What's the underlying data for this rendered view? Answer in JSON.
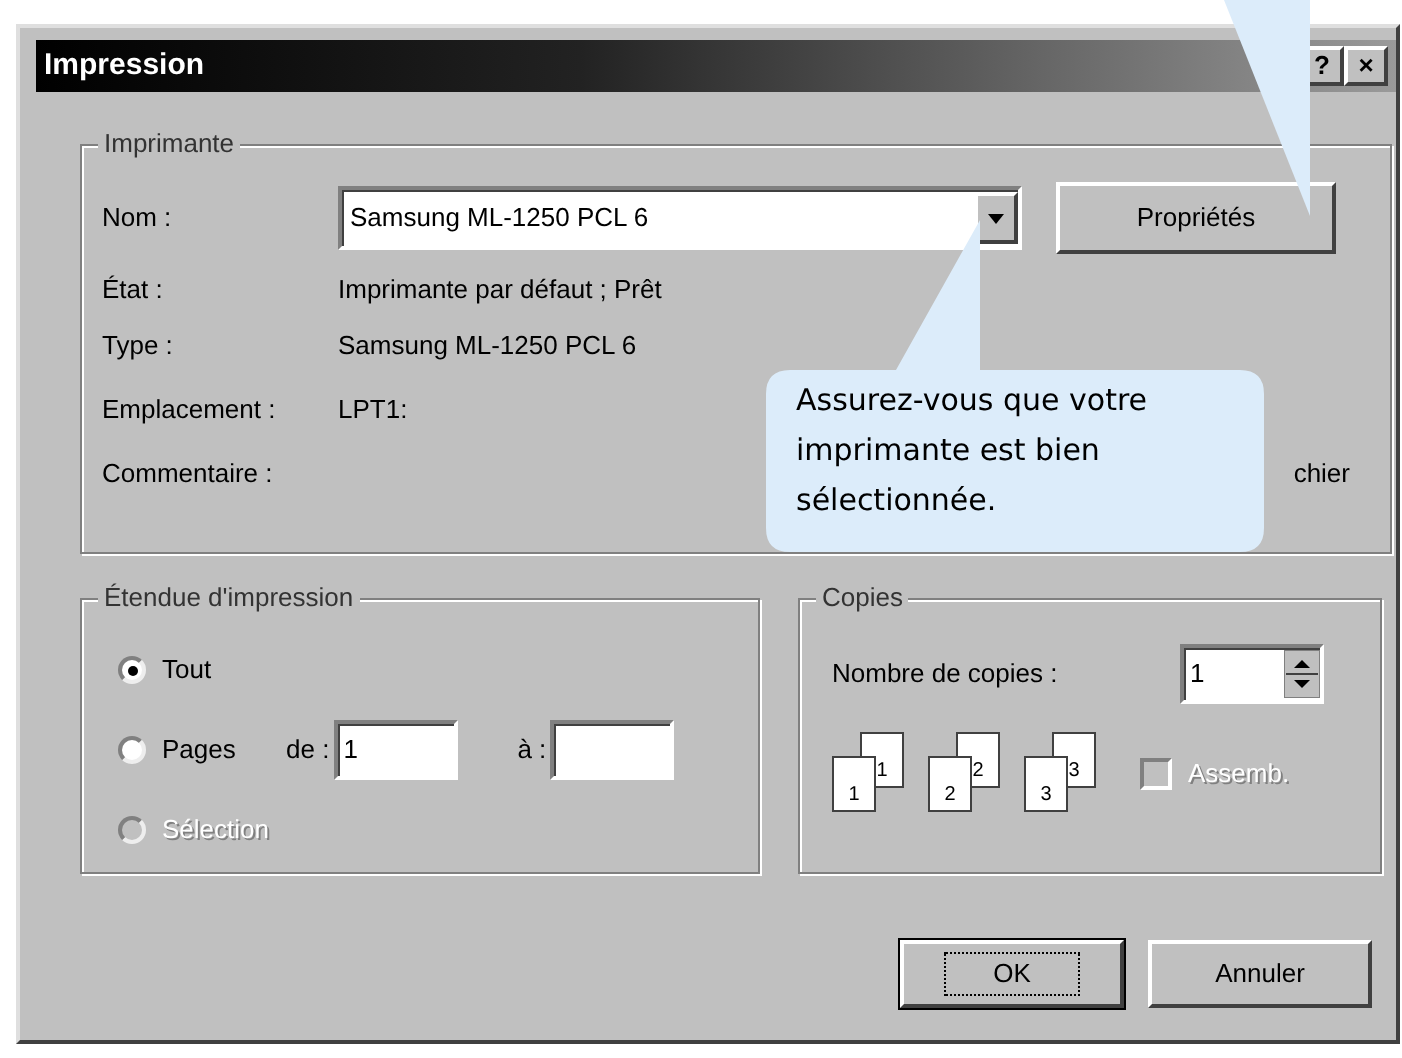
{
  "window": {
    "title": "Impression",
    "buttons": [
      "?",
      "×"
    ]
  },
  "printer": {
    "label": "Imprimante",
    "name_label": "Nom :",
    "name_value": "Samsung ML-1250 PCL 6",
    "properties_button": "Propriétés",
    "info": [
      {
        "label": "État :",
        "value": "Imprimante par défaut ; Prêt"
      },
      {
        "label": "Type :",
        "value": "Samsung ML-1250 PCL 6"
      },
      {
        "label": "Emplacement :",
        "value": "LPT1:"
      },
      {
        "label": "Commentaire :",
        "trailing": "chier"
      }
    ]
  },
  "range": {
    "label": "Étendue d'impression",
    "options": [
      {
        "label": "Tout",
        "selected": true,
        "disabled": false
      },
      {
        "label": "Pages",
        "selected": false,
        "disabled": false,
        "from_label": "de :",
        "from_value": "1",
        "to_label": "à :"
      },
      {
        "label": "Sélection",
        "selected": false,
        "disabled": true
      }
    ]
  },
  "copies": {
    "label": "Copies",
    "count_label": "Nombre de copies :",
    "count_value": "1",
    "collate_pages": [
      {
        "back": "1",
        "front": "1"
      },
      {
        "back": "2",
        "front": "2"
      },
      {
        "back": "3",
        "front": "3"
      }
    ],
    "collate": {
      "label": "Assemb.",
      "checked": false,
      "disabled": true
    }
  },
  "buttons": [
    {
      "label": "OK",
      "default": true
    },
    {
      "label": "Annuler",
      "default": false
    }
  ],
  "callout": {
    "text": "Assurez-vous que votre imprimante est bien sélectionnée."
  }
}
